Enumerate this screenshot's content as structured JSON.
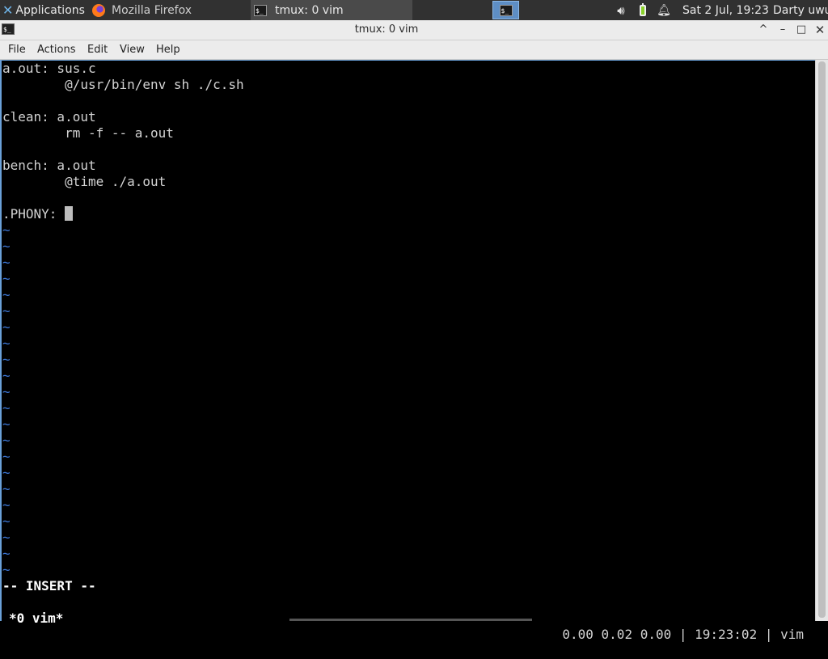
{
  "panel": {
    "apps_label": "Applications",
    "apps_icon": "xfce-x-icon",
    "tasks": [
      {
        "label": "Mozilla Firefox",
        "icon": "firefox-icon"
      },
      {
        "label": "tmux: 0 vim",
        "icon": "terminal-icon"
      }
    ],
    "workspace_icon": "terminal-icon",
    "tray": {
      "volume_icon": "speaker-icon",
      "battery_icon": "battery-icon",
      "notif_icon": "bell-icon"
    },
    "clock": "Sat  2 Jul, 19:23",
    "user": "Darty uwu"
  },
  "window": {
    "title": "tmux: 0 vim",
    "controls": {
      "shade": "^",
      "minimize": "–",
      "maximize": "□",
      "close": "✕"
    }
  },
  "menu": {
    "file": "File",
    "actions": "Actions",
    "edit": "Edit",
    "view": "View",
    "help": "Help"
  },
  "editor": {
    "lines": [
      "a.out: sus.c",
      "        @/usr/bin/env sh ./c.sh",
      "",
      "clean: a.out",
      "        rm -f -- a.out",
      "",
      "bench: a.out",
      "        @time ./a.out",
      "",
      ".PHONY: "
    ],
    "tilde": "~",
    "mode": "-- INSERT --"
  },
  "tmux": {
    "left": "*0 vim*",
    "right": "0.00 0.02 0.00 | 19:23:02 | vim"
  },
  "colors": {
    "panel_bg": "#313131",
    "accent": "#5e8ec4",
    "tilde": "#3c78d8",
    "terminal_bg": "#000000"
  }
}
